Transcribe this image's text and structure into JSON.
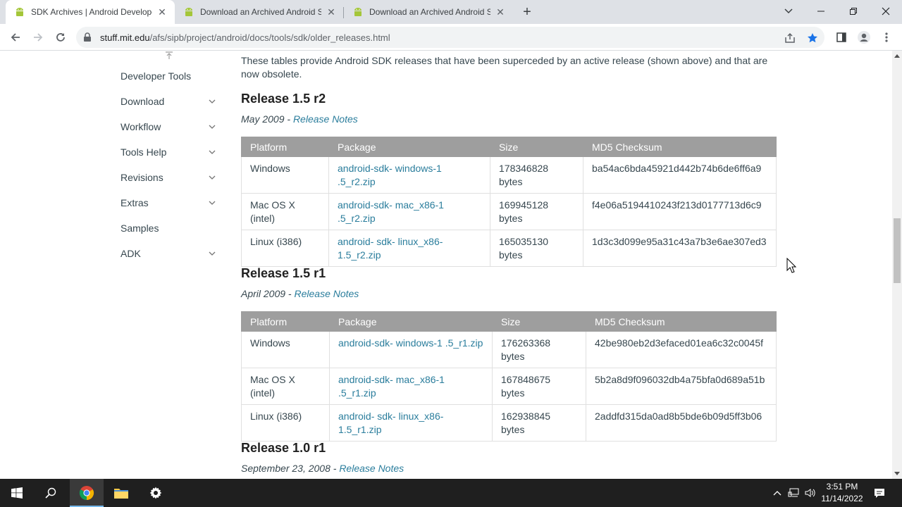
{
  "browser": {
    "tabs": [
      {
        "title": "SDK Archives | Android Develope",
        "active": true
      },
      {
        "title": "Download an Archived Android S",
        "active": false
      },
      {
        "title": "Download an Archived Android S",
        "active": false
      }
    ],
    "url_domain": "stuff.mit.edu",
    "url_path": "/afs/sipb/project/android/docs/tools/sdk/older_releases.html",
    "bookmarked": true
  },
  "sidebar": {
    "items": [
      {
        "label": "Developer Tools",
        "expandable": false
      },
      {
        "label": "Download",
        "expandable": true
      },
      {
        "label": "Workflow",
        "expandable": true
      },
      {
        "label": "Tools Help",
        "expandable": true
      },
      {
        "label": "Revisions",
        "expandable": true
      },
      {
        "label": "Extras",
        "expandable": true
      },
      {
        "label": "Samples",
        "expandable": false
      },
      {
        "label": "ADK",
        "expandable": true
      }
    ]
  },
  "content": {
    "intro": "These tables provide Android SDK releases that have been superceded by an active release (shown above) and that are now obsolete.",
    "columns": [
      "Platform",
      "Package",
      "Size",
      "MD5 Checksum"
    ],
    "releases": [
      {
        "title": "Release 1.5 r2",
        "date": "May 2009 - ",
        "notes_link": "Release Notes",
        "rows": [
          {
            "platform": "Windows",
            "package": "android-sdk- windows-1 .5_r2.zip",
            "size": "178346828",
            "unit": "bytes",
            "md5": "ba54ac6bda45921d442b74b6de6ff6a9"
          },
          {
            "platform": "Mac OS X",
            "platform2": "(intel)",
            "package": "android-sdk- mac_x86-1",
            "package2": ".5_r2.zip",
            "size": "169945128",
            "unit": "bytes",
            "md5": "f4e06a5194410243f213d0177713d6c9"
          },
          {
            "platform": "Linux (i386)",
            "package": "android- sdk- linux_x86-",
            "package2": "1.5_r2.zip",
            "size": "165035130",
            "unit": "bytes",
            "md5": "1d3c3d099e95a31c43a7b3e6ae307ed3"
          }
        ]
      },
      {
        "title": "Release 1.5 r1",
        "date": "April 2009 - ",
        "notes_link": "Release Notes",
        "rows": [
          {
            "platform": "Windows",
            "package": "android-sdk- windows-1 .5_r1.zip",
            "size": "176263368",
            "unit": "bytes",
            "md5": "42be980eb2d3efaced01ea6c32c0045f"
          },
          {
            "platform": "Mac OS X",
            "platform2": "(intel)",
            "package": "android-sdk- mac_x86-1 .5_r1.zip",
            "size": "167848675",
            "unit": "bytes",
            "md5": "5b2a8d9f096032db4a75bfa0d689a51b"
          },
          {
            "platform": "Linux (i386)",
            "package": "android- sdk- linux_x86-",
            "package2": "1.5_r1.zip",
            "size": "162938845",
            "unit": "bytes",
            "md5": "2addfd315da0ad8b5bde6b09d5ff3b06"
          }
        ]
      },
      {
        "title": "Release 1.0 r1",
        "date": "September 23, 2008 - ",
        "notes_link": "Release Notes"
      }
    ]
  },
  "taskbar": {
    "time": "3:51 PM",
    "date": "11/14/2022"
  },
  "colors": {
    "link": "#2a7d9c",
    "table_header": "#9e9e9e",
    "taskbar": "#1f1f1f",
    "bookmark_star": "#1a73e8"
  }
}
